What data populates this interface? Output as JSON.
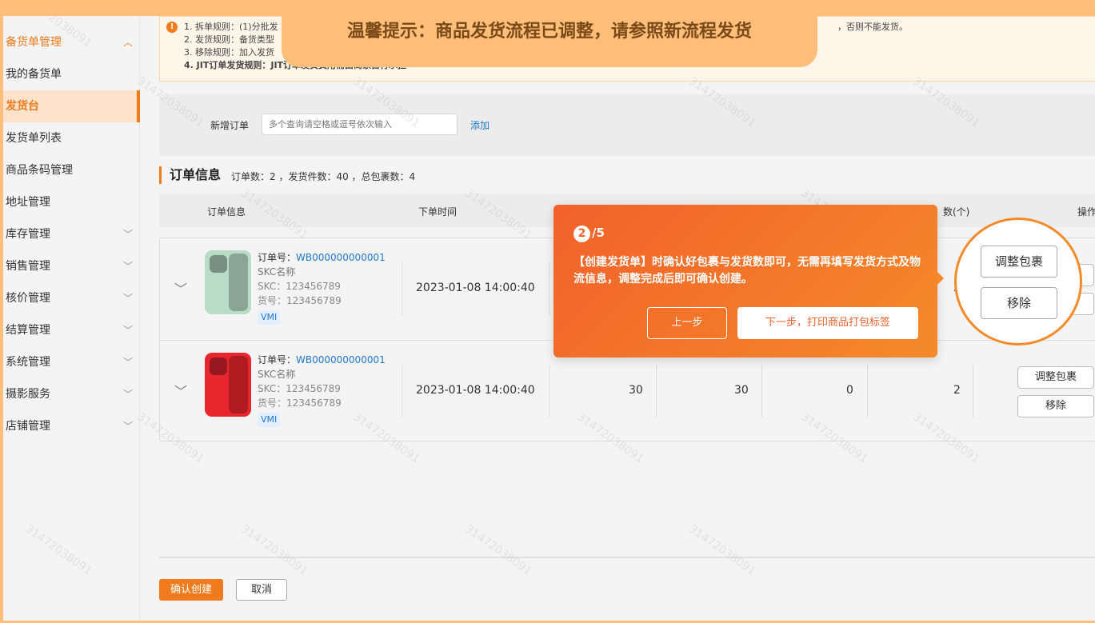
{
  "tip_banner": "温馨提示：商品发货流程已调整，请参照新流程发货",
  "sidebar": {
    "items": [
      {
        "label": "备货单管理",
        "chevron": "︿"
      },
      {
        "label": "我的备货单"
      },
      {
        "label": "发货台"
      },
      {
        "label": "发货单列表"
      },
      {
        "label": "商品条码管理"
      },
      {
        "label": "地址管理"
      },
      {
        "label": "库存管理",
        "chevron": "﹀"
      },
      {
        "label": "销售管理",
        "chevron": "﹀"
      },
      {
        "label": "核价管理",
        "chevron": "﹀"
      },
      {
        "label": "结算管理",
        "chevron": "﹀"
      },
      {
        "label": "系统管理",
        "chevron": "﹀"
      },
      {
        "label": "摄影服务",
        "chevron": "﹀"
      },
      {
        "label": "店铺管理",
        "chevron": "﹀"
      }
    ]
  },
  "notice": {
    "icon": "!",
    "lines": [
      "1. 拆单规则：(1)分批发",
      "2. 发货规则：备货类型",
      "3. 移除规则：加入发货",
      "4. JIT订单发货规则：JIT订单发货费用需由商家自行承担"
    ],
    "tail": "，否则不能发货。"
  },
  "add_order": {
    "label": "新增订单",
    "placeholder": "多个查询请空格或逗号依次输入",
    "add_link": "添加"
  },
  "section": {
    "title": "订单信息",
    "stats": "订单数：2 ，发货件数：40 ，总包裹数：4"
  },
  "table": {
    "headers": {
      "order_info": "订单信息",
      "order_time": "下单时间",
      "qty_partial": "数(个)",
      "action": "操作"
    },
    "rows": [
      {
        "order_no_label": "订单号：",
        "order_no": "WB000000000001",
        "skc_name": "SKC名称",
        "skc": "SKC：123456789",
        "item_no": "货号：123456789",
        "tag": "VMI",
        "time": "2023-01-08 14:00:40",
        "c1": "",
        "c2": "",
        "c3": "",
        "c4": "2",
        "phone_color": "#b9dcc6"
      },
      {
        "order_no_label": "订单号：",
        "order_no": "WB000000000001",
        "skc_name": "SKC名称",
        "skc": "SKC：123456789",
        "item_no": "货号：123456789",
        "tag": "VMI",
        "time": "2023-01-08 14:00:40",
        "c1": "30",
        "c2": "30",
        "c3": "0",
        "c4": "2",
        "phone_color": "#e8262e"
      }
    ],
    "actions": {
      "adjust": "调整包裹",
      "remove": "移除"
    }
  },
  "footer": {
    "confirm": "确认创建",
    "cancel": "取消"
  },
  "guide": {
    "step_num": "2",
    "step_total": "/5",
    "desc": "【创建发货单】时确认好包裹与发货数即可，无需再填写发货方式及物流信息，调整完成后即可确认创建。",
    "prev": "上一步",
    "next": "下一步，打印商品打包标签"
  },
  "spotlight": {
    "adjust": "调整包裹",
    "remove": "移除"
  },
  "watermark": "31472038091",
  "colors": {
    "accent": "#f07b1d",
    "link": "#1e78d2",
    "banner": "#ffbf7a"
  }
}
